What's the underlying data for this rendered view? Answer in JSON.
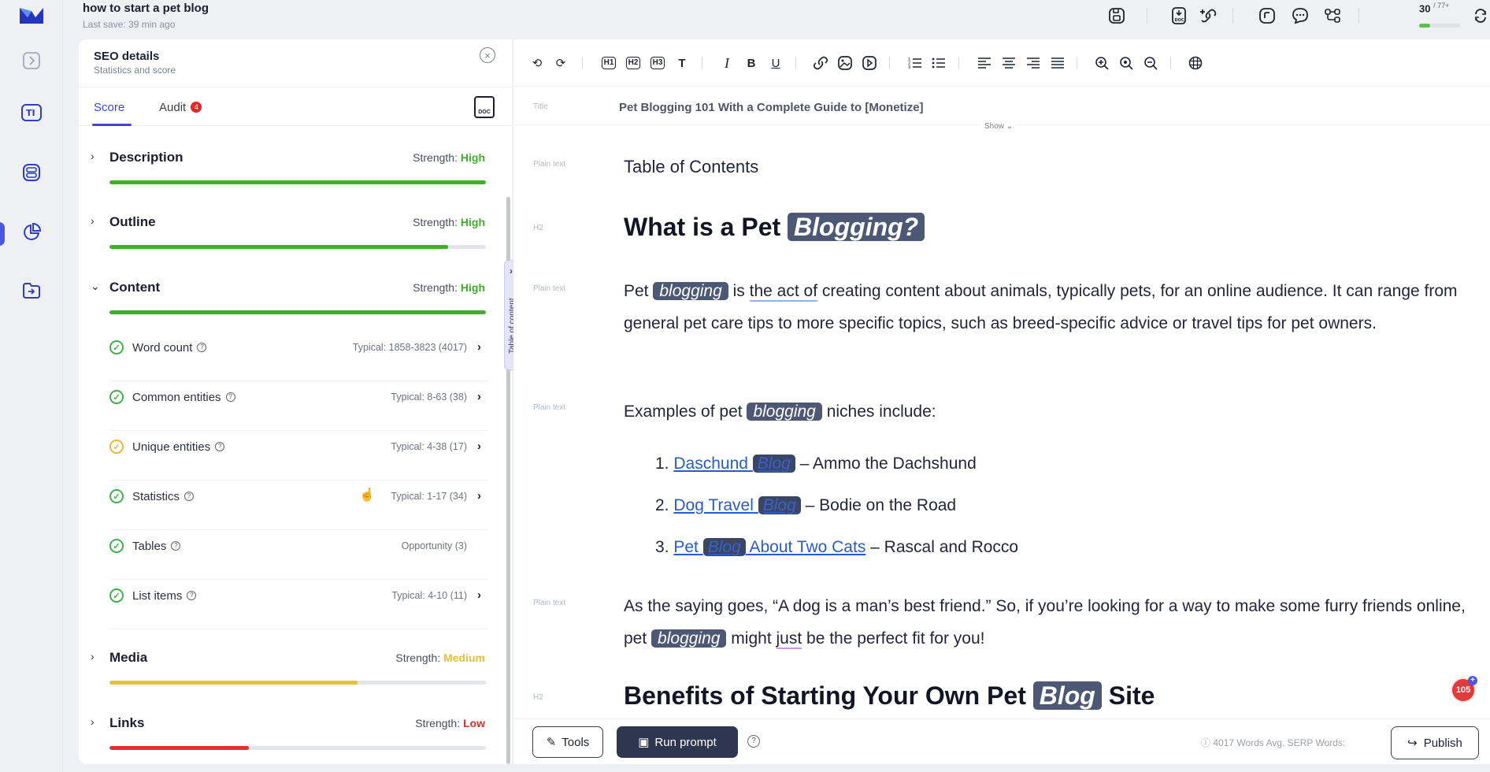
{
  "app": {
    "doc_title": "how to start a pet blog",
    "last_save": "Last save:  39 min ago",
    "counter": "30",
    "counter_sup": "/ 77+",
    "counter_progress": 0.26
  },
  "rail": {
    "icons": [
      "logo-icon",
      "chevron-right-icon",
      "text-tool-icon",
      "layers-icon",
      "pie-chart-icon",
      "folder-import-icon"
    ]
  },
  "topbar_icons": [
    "save-icon",
    "export-doc-icon",
    "add-link-icon",
    "chart-icon",
    "comment-icon",
    "share-network-icon",
    "refresh-icon"
  ],
  "seo": {
    "title": "SEO details",
    "subtitle": "Statistics and score",
    "tabs": {
      "score": "Score",
      "audit": "Audit",
      "audit_badge": "4"
    },
    "doc_icon_label": "DOC",
    "strength_label": "Strength:",
    "sections": [
      {
        "name": "Description",
        "strength": "High",
        "color": "#3fae2a",
        "progress": 1.0,
        "expanded": false
      },
      {
        "name": "Outline",
        "strength": "High",
        "color": "#3fae2a",
        "progress": 0.9,
        "expanded": false
      },
      {
        "name": "Content",
        "strength": "High",
        "color": "#3fae2a",
        "progress": 1.0,
        "expanded": true
      },
      {
        "name": "Media",
        "strength": "Medium",
        "color": "#e9bf3a",
        "progress": 0.66,
        "expanded": false
      },
      {
        "name": "Links",
        "strength": "Low",
        "color": "#e0312d",
        "progress": 0.37,
        "expanded": false
      }
    ],
    "content_items": [
      {
        "label": "Word count",
        "typical": "Typical:  1858-3823  (4017)",
        "status": "ok",
        "arrow": true
      },
      {
        "label": "Common entities",
        "typical": "Typical:  8-63  (38)",
        "status": "ok",
        "arrow": true
      },
      {
        "label": "Unique entities",
        "typical": "Typical:  4-38  (17)",
        "status": "warn",
        "arrow": true
      },
      {
        "label": "Statistics",
        "typical": "Typical:  1-17  (34)",
        "status": "ok",
        "arrow": true
      },
      {
        "label": "Tables",
        "typical": "Opportunity  (3)",
        "status": "ok",
        "arrow": false
      },
      {
        "label": "List items",
        "typical": "Typical:  4-10  (11)",
        "status": "ok",
        "arrow": true
      }
    ],
    "toc_tab": "Table of content"
  },
  "editor": {
    "title_gutter": "Title",
    "title": "Pet Blogging 101 With a Complete Guide to [Monetize]",
    "show": "Show",
    "gutter": {
      "plain": "Plain text",
      "h2": "H2"
    },
    "toc_heading": "Table of Contents",
    "h2_1": {
      "pre": "What is a Pet",
      "hl": "Blogging?"
    },
    "p1": {
      "a": "Pet",
      "hl": "blogging",
      "b": "is",
      "u": "the act of",
      "c": "creating content about animals, typically pets, for an online audience. It can range from general pet care tips to more specific topics, such as breed-specific advice or travel tips for pet owners."
    },
    "p2": {
      "a": "Examples of pet",
      "hl": "blogging",
      "b": "niches include:"
    },
    "list": [
      {
        "num": "1.",
        "link_a": "Daschund",
        "hl": "Blog",
        "link_b": "",
        "rest": "– Ammo the Dachshund"
      },
      {
        "num": "2.",
        "link_a": "Dog Travel",
        "hl": "Blog",
        "link_b": "",
        "rest": "– Bodie on the Road"
      },
      {
        "num": "3.",
        "link_a": "Pet",
        "hl": "Blog",
        "link_b": "About Two Cats",
        "rest": "– Rascal and Rocco"
      }
    ],
    "p3": {
      "a": "As the saying goes, “A dog is a man’s best friend.” So, if you’re looking for a way to make some furry friends online, pet",
      "hl": "blogging",
      "b": "might",
      "u": "just",
      "c": "be the perfect fit for you!"
    },
    "h2_2": {
      "pre": "Benefits of Starting Your Own Pet",
      "hl": "Blog",
      "post": "Site"
    }
  },
  "bottom": {
    "tools": "Tools",
    "run_prompt": "Run prompt",
    "words": "4017 Words   Avg. SERP Words:",
    "publish": "Publish"
  },
  "notification": {
    "count": "105"
  }
}
